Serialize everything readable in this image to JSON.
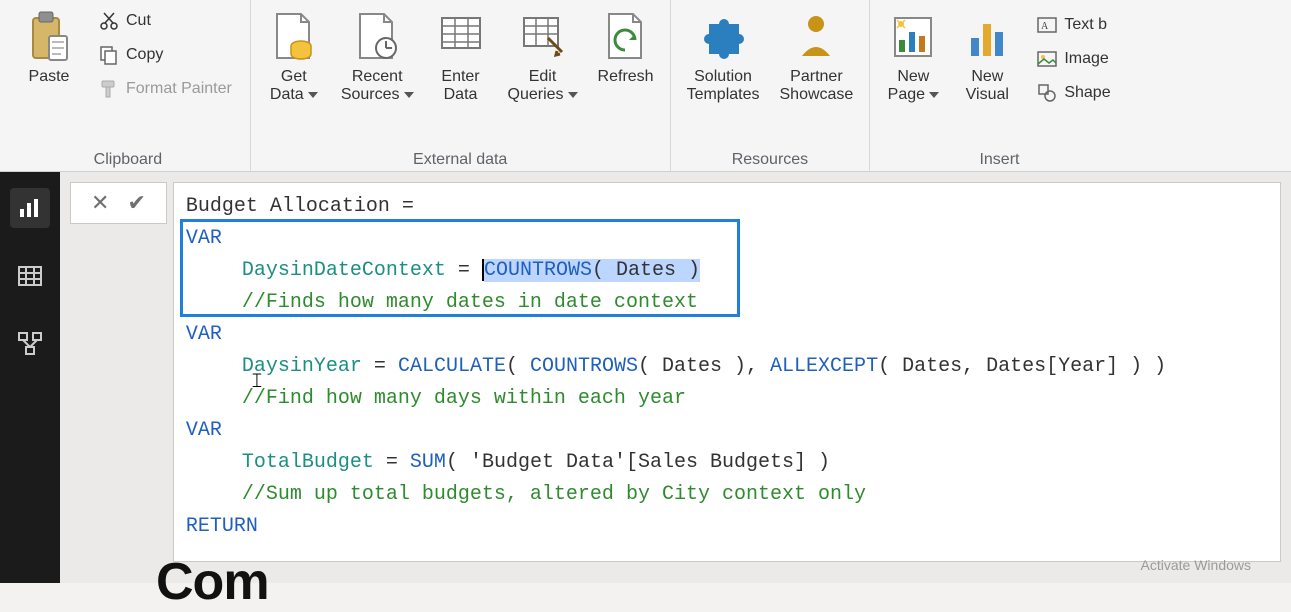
{
  "ribbon": {
    "clipboard": {
      "label": "Clipboard",
      "paste": "Paste",
      "cut": "Cut",
      "copy": "Copy",
      "formatPainter": "Format Painter"
    },
    "externalData": {
      "label": "External data",
      "getData": "Get\nData",
      "recentSources": "Recent\nSources",
      "enterData": "Enter\nData",
      "editQueries": "Edit\nQueries",
      "refresh": "Refresh"
    },
    "resources": {
      "label": "Resources",
      "solutionTemplates": "Solution\nTemplates",
      "partnerShowcase": "Partner\nShowcase"
    },
    "insert": {
      "label": "Insert",
      "newPage": "New\nPage",
      "newVisual": "New\nVisual",
      "textBox": "Text b",
      "image": "Image",
      "shapes": "Shape"
    }
  },
  "formula": {
    "measureName": "Budget Allocation = ",
    "kwVAR": "VAR",
    "kwRETURN": "RETURN",
    "var1_name": "DaysinDateContext",
    "var1_eq": " = ",
    "var1_fn": "COUNTROWS",
    "var1_args": "( Dates )",
    "var1_comment": "//Finds how many dates in date context",
    "var2_name_a": "D",
    "var2_name_b": "aysinYear",
    "var2_eq": " = ",
    "var2_fn1": "CALCULATE",
    "var2_paren1": "( ",
    "var2_fn2": "COUNTROWS",
    "var2_args2": "( Dates ), ",
    "var2_fn3": "ALLEXCEPT",
    "var2_args3": "( Dates, Dates[Year] ) )",
    "var2_comment": "//Find how many days within each year",
    "var3_name": "TotalBudget",
    "var3_eq": " = ",
    "var3_fn": "SUM",
    "var3_args": "( 'Budget Data'[Sales Budgets] )",
    "var3_comment": "//Sum up total budgets, altered by City context only"
  },
  "page": {
    "reportTitlePartial": "Com",
    "watermark": "Activate Windows"
  }
}
